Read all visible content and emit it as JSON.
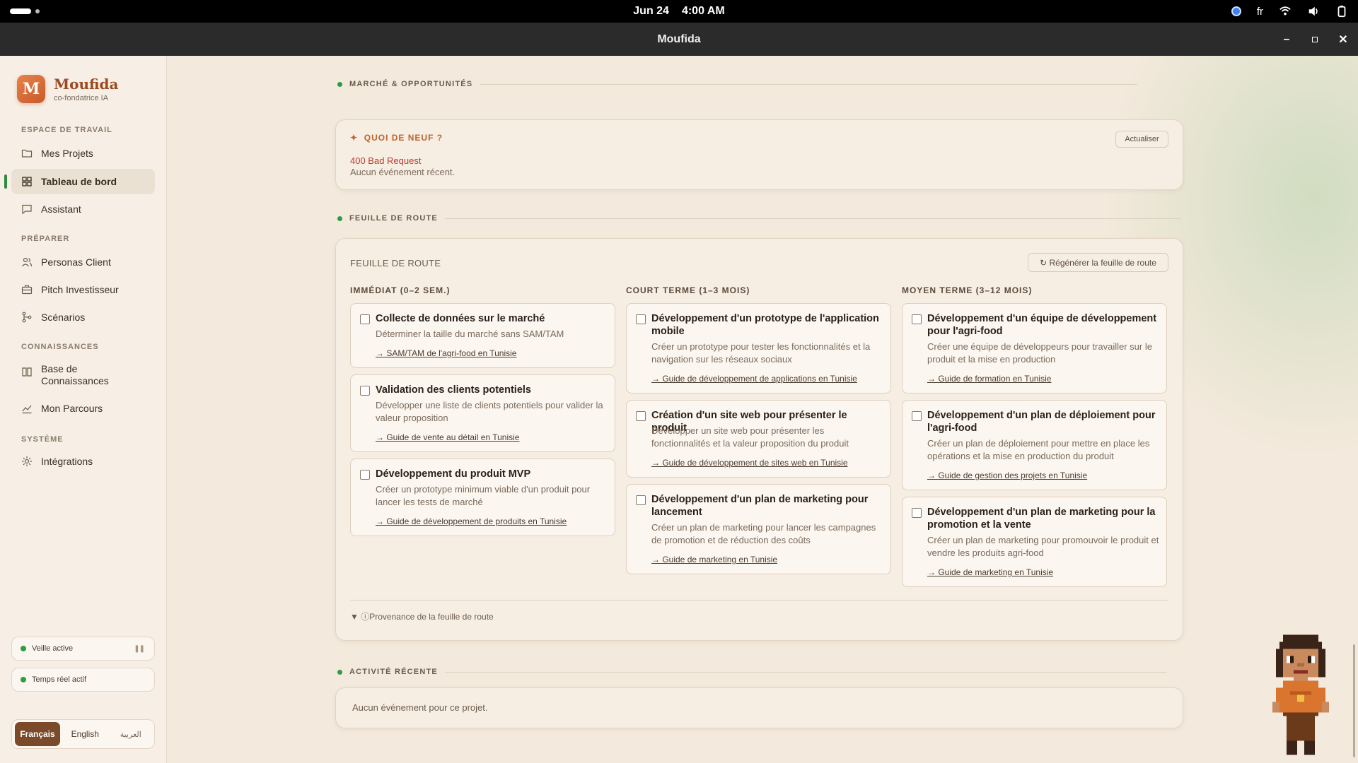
{
  "system_bar": {
    "date": "Jun 24",
    "time": "4:00 AM",
    "lang": "fr"
  },
  "window": {
    "title": "Moufida"
  },
  "sidebar": {
    "brand_name": "Moufida",
    "brand_sub": "co-fondatrice IA",
    "logo_letter": "M",
    "sections": [
      {
        "label": "ESPACE DE TRAVAIL",
        "items": [
          {
            "label": "Mes Projets",
            "icon": "folder-icon"
          },
          {
            "label": "Tableau de bord",
            "icon": "dashboard-icon",
            "active": true
          },
          {
            "label": "Assistant",
            "icon": "chat-icon"
          }
        ]
      },
      {
        "label": "PRÉPARER",
        "items": [
          {
            "label": "Personas Client",
            "icon": "users-icon"
          },
          {
            "label": "Pitch Investisseur",
            "icon": "briefcase-icon"
          },
          {
            "label": "Scénarios",
            "icon": "branch-icon"
          }
        ]
      },
      {
        "label": "CONNAISSANCES",
        "items": [
          {
            "label": "Base de Connaissances",
            "icon": "book-icon"
          },
          {
            "label": "Mon Parcours",
            "icon": "chart-line-icon"
          }
        ]
      },
      {
        "label": "SYSTÈME",
        "items": [
          {
            "label": "Intégrations",
            "icon": "gear-icon"
          }
        ]
      }
    ],
    "status": {
      "watch": "Veille active",
      "realtime": "Temps réel actif"
    },
    "languages": {
      "fr": "Français",
      "en": "English",
      "ar": "العربية"
    }
  },
  "market_section": {
    "heading": "MARCHÉ & OPPORTUNITÉS",
    "news_title": "QUOI DE NEUF ?",
    "refresh_label": "Actualiser",
    "error_text": "400 Bad Request",
    "empty_text": "Aucun événement récent."
  },
  "roadmap_section": {
    "heading": "FEUILLE DE ROUTE",
    "card_title": "FEUILLE DE ROUTE",
    "regenerate_label": "Régénérer la feuille de route",
    "provenance_label": "Provenance de la feuille de route",
    "columns": [
      {
        "label": "IMMÉDIAT (0–2 SEM.)",
        "tasks": [
          {
            "title": "Collecte de données sur le marché",
            "desc": "Déterminer la taille du marché sans SAM/TAM",
            "link": "→ SAM/TAM de l'agri-food en Tunisie"
          },
          {
            "title": "Validation des clients potentiels",
            "desc": "Développer une liste de clients potentiels pour valider la valeur proposition",
            "link": "→ Guide de vente au détail en Tunisie"
          },
          {
            "title": "Développement du produit MVP",
            "desc": "Créer un prototype minimum viable d'un produit pour lancer les tests de marché",
            "link": "→ Guide de développement de produits en Tunisie"
          }
        ]
      },
      {
        "label": "COURT TERME (1–3 MOIS)",
        "tasks": [
          {
            "title": "Développement d'un prototype de l'application mobile",
            "desc": "Créer un prototype pour tester les fonctionnalités et la navigation sur les réseaux sociaux",
            "link": "→ Guide de développement de applications en Tunisie"
          },
          {
            "title": "Création d'un site web pour présenter le produit",
            "desc": "Développer un site web pour présenter les fonctionnalités et la valeur proposition du produit",
            "link": "→ Guide de développement de sites web en Tunisie"
          },
          {
            "title": "Développement d'un plan de marketing pour lancement",
            "desc": "Créer un plan de marketing pour lancer les campagnes de promotion et de réduction des coûts",
            "link": "→ Guide de marketing en Tunisie"
          }
        ]
      },
      {
        "label": "MOYEN TERME (3–12 MOIS)",
        "tasks": [
          {
            "title": "Développement d'un équipe de développement pour l'agri-food",
            "desc": "Créer une équipe de développeurs pour travailler sur le produit et la mise en production",
            "link": "→ Guide de formation en Tunisie"
          },
          {
            "title": "Développement d'un plan de déploiement pour l'agri-food",
            "desc": "Créer un plan de déploiement pour mettre en place les opérations et la mise en production du produit",
            "link": "→ Guide de gestion des projets en Tunisie"
          },
          {
            "title": "Développement d'un plan de marketing pour la promotion et la vente",
            "desc": "Créer un plan de marketing pour promouvoir le produit et vendre les produits agri-food",
            "link": "→ Guide de marketing en Tunisie"
          }
        ]
      }
    ]
  },
  "activity_section": {
    "heading": "ACTIVITÉ RÉCENTE",
    "empty_text": "Aucun événement pour ce projet."
  },
  "colors": {
    "accent": "#c0632d",
    "active_green": "#2e9b47",
    "error": "#b83a2a"
  }
}
